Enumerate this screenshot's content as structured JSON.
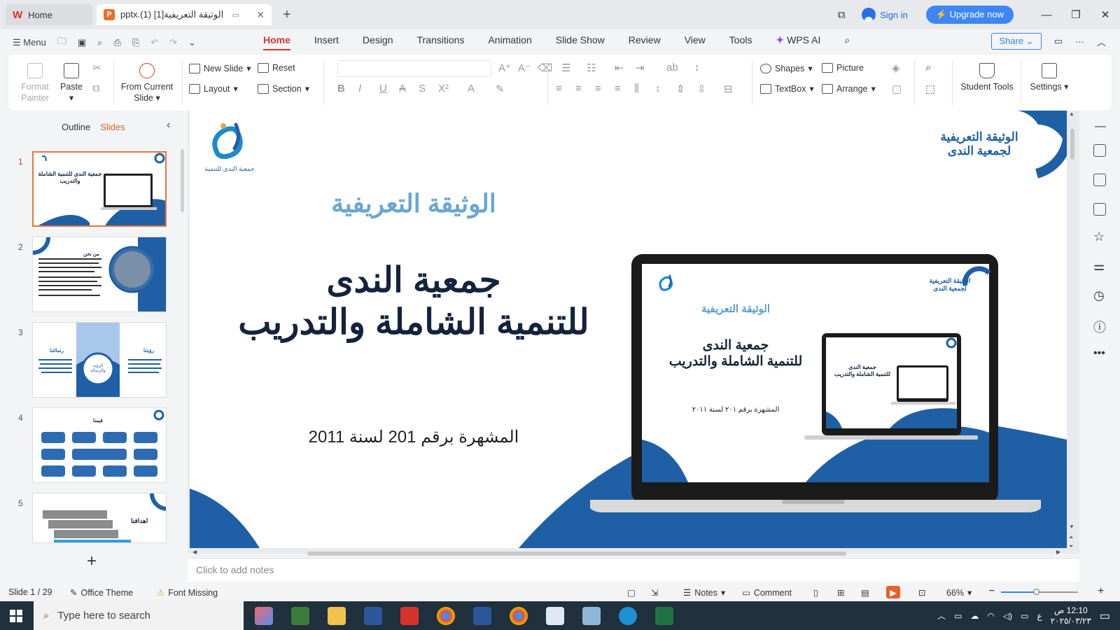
{
  "titlebar": {
    "home_tab": "Home",
    "doc_tab": "الوثيقة التعريفية[1] (1).pptx",
    "signin": "Sign in",
    "upgrade": "Upgrade now"
  },
  "menubar": {
    "menu_label": "Menu",
    "tabs": [
      "Home",
      "Insert",
      "Design",
      "Transitions",
      "Animation",
      "Slide Show",
      "Review",
      "View",
      "Tools"
    ],
    "active_tab": "Home",
    "wps_ai": "WPS AI",
    "share": "Share"
  },
  "ribbon": {
    "format_painter": "Format Painter",
    "paste": "Paste",
    "from_current_slide": "From Current Slide",
    "new_slide": "New Slide",
    "reset": "Reset",
    "layout": "Layout",
    "section": "Section",
    "shapes": "Shapes",
    "picture": "Picture",
    "textbox": "TextBox",
    "arrange": "Arrange",
    "student_tools": "Student Tools",
    "settings": "Settings"
  },
  "left_panel": {
    "outline_tab": "Outline",
    "slides_tab": "Slides",
    "slide_numbers": [
      "1",
      "2",
      "3",
      "4",
      "5"
    ],
    "active_slide": 1,
    "thumb_texts": {
      "s1_title": "جمعية الندى للتنمية الشاملة والتدريب",
      "s2_title": "من نحن",
      "s3_left": "رسالتنا",
      "s3_mid": "الرؤية والرسالة",
      "s3_right": "رؤيتنا",
      "s4_title": "قيمنا",
      "s5_title": "اهدافنا"
    }
  },
  "slide": {
    "logo_caption": "جمعية الندى للتنمية",
    "corner_title_line1": "الوثيقة التعريفية",
    "corner_title_line2": "لجمعية الندى",
    "subtitle": "الوثيقة التعريفية",
    "title_line1": "جمعية الندى",
    "title_line2": "للتنمية الشاملة والتدريب",
    "registration": "المشهرة برقم 201 لسنة 2011",
    "laptop_subtitle": "الوثيقة التعريفية",
    "laptop_title_line1": "جمعية الندى",
    "laptop_title_line2": "للتنمية الشاملة والتدريب",
    "laptop_registration": "المشهرة برقم ٢٠١ لسنة ٢٠١١",
    "laptop_corner_line1": "الوثيقة التعريفية",
    "laptop_corner_line2": "لجمعية الندى",
    "colors": {
      "blue": "#1f5fa6",
      "light_blue": "#5b9fd0",
      "navy": "#14233d"
    }
  },
  "notes_placeholder": "Click to add notes",
  "statusbar": {
    "slide_counter": "Slide 1 / 29",
    "theme": "Office Theme",
    "font_missing": "Font Missing",
    "notes": "Notes",
    "comment": "Comment",
    "zoom": "66%",
    "zoom_level": 0.45
  },
  "taskbar": {
    "search_placeholder": "Type here to search",
    "time": "12:10 ص",
    "date": "٢٠٢٥/٠٣/٢٣",
    "lang": "ع"
  }
}
